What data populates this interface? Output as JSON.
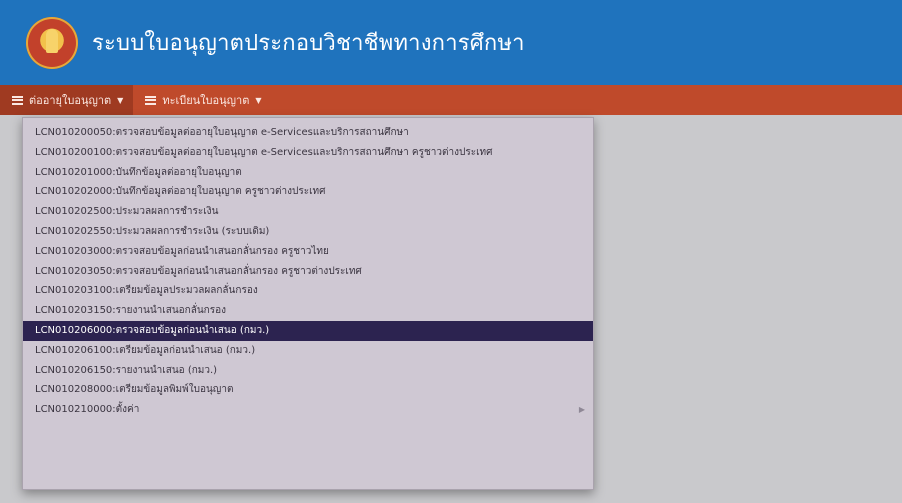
{
  "header": {
    "title": "ระบบใบอนุญาตประกอบวิชาชีพทางการศึกษา",
    "colors": {
      "header_bg": "#1f73bd",
      "navbar_bg": "#bf4a2b",
      "menu_bg": "#cfc8d3",
      "selected_bg": "#2c2350"
    }
  },
  "navbar": {
    "items": [
      {
        "label": "ต่ออายุใบอนุญาต",
        "icon": "list-icon"
      },
      {
        "label": "ทะเบียนใบอนุญาต",
        "icon": "list-icon"
      }
    ]
  },
  "dropdown": {
    "items": [
      {
        "label": "LCN010200050:ตรวจสอบข้อมูลต่ออายุใบอนุญาต e-Servicesและบริการสถานศึกษา"
      },
      {
        "label": "LCN010200100:ตรวจสอบข้อมูลต่ออายุใบอนุญาต e-Servicesและบริการสถานศึกษา ครูชาวต่างประเทศ"
      },
      {
        "label": "LCN010201000:บันทึกข้อมูลต่ออายุใบอนุญาต"
      },
      {
        "label": "LCN010202000:บันทึกข้อมูลต่ออายุใบอนุญาต ครูชาวต่างประเทศ"
      },
      {
        "label": "LCN010202500:ประมวลผลการชำระเงิน"
      },
      {
        "label": "LCN010202550:ประมวลผลการชำระเงิน (ระบบเดิม)"
      },
      {
        "label": "LCN010203000:ตรวจสอบข้อมูลก่อนนำเสนอกลั่นกรอง ครูชาวไทย"
      },
      {
        "label": "LCN010203050:ตรวจสอบข้อมูลก่อนนำเสนอกลั่นกรอง ครูชาวต่างประเทศ"
      },
      {
        "label": "LCN010203100:เตรียมข้อมูลประมวลผลกลั่นกรอง"
      },
      {
        "label": "LCN010203150:รายงานนำเสนอกลั่นกรอง"
      },
      {
        "label": "LCN010206000:ตรวจสอบข้อมูลก่อนนำเสนอ (กมว.)"
      },
      {
        "label": "LCN010206100:เตรียมข้อมูลก่อนนำเสนอ (กมว.)"
      },
      {
        "label": "LCN010206150:รายงานนำเสนอ (กมว.)"
      },
      {
        "label": "LCN010208000:เตรียมข้อมูลพิมพ์ใบอนุญาต"
      },
      {
        "label": "LCN010210000:ตั้งค่า",
        "submenu_icon": "chevron-right-icon"
      }
    ],
    "selected_index": 10
  }
}
